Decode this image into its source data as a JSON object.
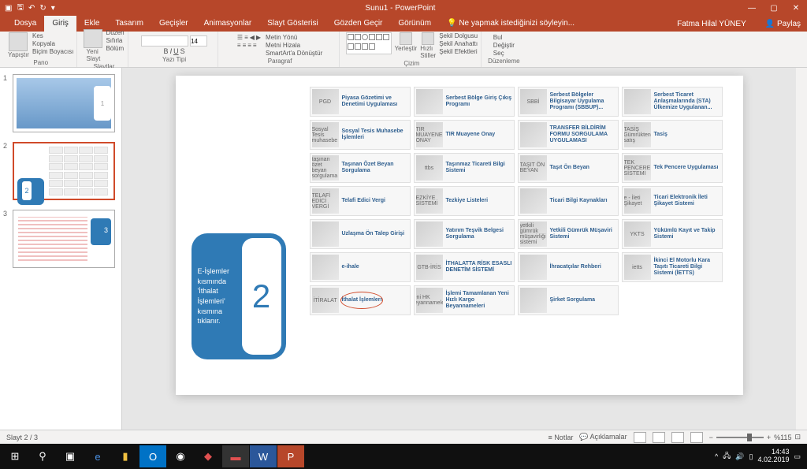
{
  "title": "Sunu1 - PowerPoint",
  "user": "Fatma Hilal YÜNEY",
  "share": "Paylaş",
  "tabs": [
    "Dosya",
    "Giriş",
    "Ekle",
    "Tasarım",
    "Geçişler",
    "Animasyonlar",
    "Slayt Gösterisi",
    "Gözden Geçir",
    "Görünüm"
  ],
  "tell": "Ne yapmak istediğinizi söyleyin...",
  "ribbon": {
    "paste": "Yapıştır",
    "cut": "Kes",
    "copy": "Kopyala",
    "fmt": "Biçim Boyacısı",
    "new": "Yeni\nSlayt",
    "layout": "Düzen",
    "reset": "Sıfırla",
    "section": "Bölüm",
    "font": "",
    "size": "14",
    "textdir": "Metin Yönü",
    "align": "Metni Hizala",
    "smart": "SmartArt'a Dönüştür",
    "arrange": "Yerleştir",
    "quick": "Hızlı\nStiller",
    "fill": "Şekil Dolgusu",
    "outline": "Şekil Anahattı",
    "effects": "Şekil Efektleri",
    "find": "Bul",
    "replace": "Değiştir",
    "select": "Seç",
    "g1": "Pano",
    "g2": "Slaytlar",
    "g3": "Yazı Tipi",
    "g4": "Paragraf",
    "g5": "Çizim",
    "g6": "Düzenleme"
  },
  "callout": "E-İşlemler kısmında 'İthalat İşlemleri' kısmına tıklanır.",
  "cards": [
    {
      "icon": "PGD",
      "label": "Piyasa Gözetimi ve Denetimi Uygulaması"
    },
    {
      "icon": "",
      "label": "Serbest Bölge Giriş Çıkış Programı"
    },
    {
      "icon": "SBBİ",
      "label": "Serbest Bölgeler Bilgisayar Uygulama Programı (SBBUP)..."
    },
    {
      "icon": "",
      "label": "Serbest Ticaret Anlaşmalarında (STA) Ülkemize Uygulanan..."
    },
    {
      "icon": "Sosyal Tesis muhasebe",
      "label": "Sosyal Tesis Muhasebe İşlemleri"
    },
    {
      "icon": "TIR MUAYENE ONAY",
      "label": "TIR Muayene Onay"
    },
    {
      "icon": "",
      "label": "TRANSFER BİLDİRİM FORMU SORGULAMA UYGULAMASI"
    },
    {
      "icon": "TASİŞ Gümrükten satış",
      "label": "Tasiş"
    },
    {
      "icon": "taşınan özet beyan sorgulama",
      "label": "Taşınan Özet Beyan Sorgulama"
    },
    {
      "icon": "ttbs",
      "label": "Taşınmaz Ticareti Bilgi Sistemi"
    },
    {
      "icon": "TAŞIT ÖN BEYAN",
      "label": "Taşıt Ön Beyan"
    },
    {
      "icon": "TEK PENCERE SİSTEMİ",
      "label": "Tek Pencere Uygulaması"
    },
    {
      "icon": "TELAFİ EDİCİ VERGİ",
      "label": "Telafi Edici Vergi"
    },
    {
      "icon": "EZKİYE SİSTEMİ",
      "label": "Tezkiye Listeleri"
    },
    {
      "icon": "",
      "label": "Ticari Bilgi Kaynakları"
    },
    {
      "icon": "e - İleti Şikayet",
      "label": "Ticari Elektronik İleti Şikayet Sistemi"
    },
    {
      "icon": "",
      "label": "Uzlaşma Ön Talep Girişi"
    },
    {
      "icon": "",
      "label": "Yatırım Teşvik Belgesi Sorgulama"
    },
    {
      "icon": "yetkili gümrük müşavirliği sistemi",
      "label": "Yetkili Gümrük Müşaviri Sistemi"
    },
    {
      "icon": "YKTS",
      "label": "Yükümlü Kayıt ve Takip Sistemi"
    },
    {
      "icon": "",
      "label": "e-ihale"
    },
    {
      "icon": "GTB-İRİS",
      "label": "İTHALATTA RİSK ESASLI DENETİM SİSTEMİ"
    },
    {
      "icon": "",
      "label": "İhracatçılar Rehberi"
    },
    {
      "icon": "ietts",
      "label": "İkinci El Motorlu Kara Taşıtı Ticareti Bilgi Sistemi (İETTS)"
    },
    {
      "icon": "İTİRALAT",
      "label": "İthalat İşlemleri",
      "circled": true
    },
    {
      "icon": "yeni HK Beyannameleri",
      "label": "İşlemi Tamamlanan Yeni Hızlı Kargo Beyannameleri"
    },
    {
      "icon": "",
      "label": "Şirket Sorgulama"
    }
  ],
  "status": {
    "left": "Slayt 2 / 3",
    "notes": "Notlar",
    "comments": "Açıklamalar",
    "zoom": "%115"
  },
  "clock": {
    "time": "14:43",
    "date": "4.02.2019"
  }
}
